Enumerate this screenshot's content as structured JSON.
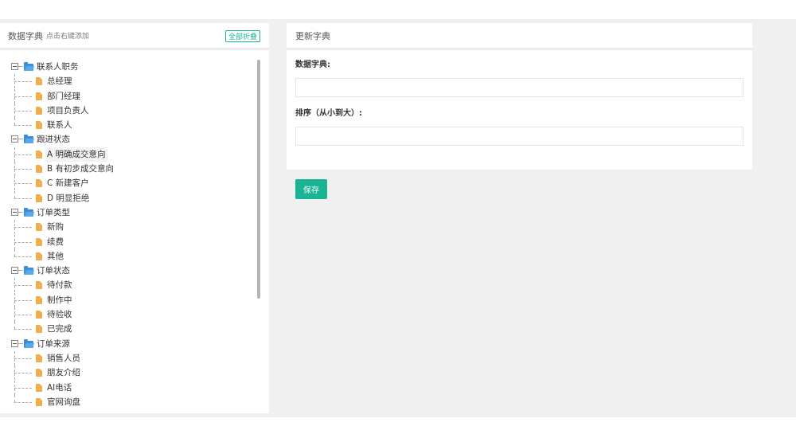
{
  "left_panel": {
    "title": "数据字典",
    "hint": "点击右键添加",
    "collapse_label": "全部折叠"
  },
  "tree": [
    {
      "label": "联系人职务",
      "children": [
        "总经理",
        "部门经理",
        "项目负责人",
        "联系人"
      ]
    },
    {
      "label": "跟进状态",
      "children": [
        "A 明确成交意向",
        "B 有初步成交意向",
        "C 新建客户",
        "D 明显拒绝"
      ]
    },
    {
      "label": "订单类型",
      "children": [
        "新购",
        "续费",
        "其他"
      ]
    },
    {
      "label": "订单状态",
      "children": [
        "待付款",
        "制作中",
        "待验收",
        "已完成"
      ]
    },
    {
      "label": "订单来源",
      "children": [
        "销售人员",
        "朋友介绍",
        "AI电话",
        "官网询盘"
      ]
    }
  ],
  "selected_item": "A 明确成交意向",
  "right_panel": {
    "title": "更新字典",
    "field1_label": "数据字典:",
    "field1_value": "",
    "field2_label": "排序（从小到大）:",
    "field2_value": "",
    "save_label": "保存"
  },
  "colors": {
    "accent": "#1ab394",
    "folder": "#3d8ed6",
    "file": "#f0ad4e"
  }
}
